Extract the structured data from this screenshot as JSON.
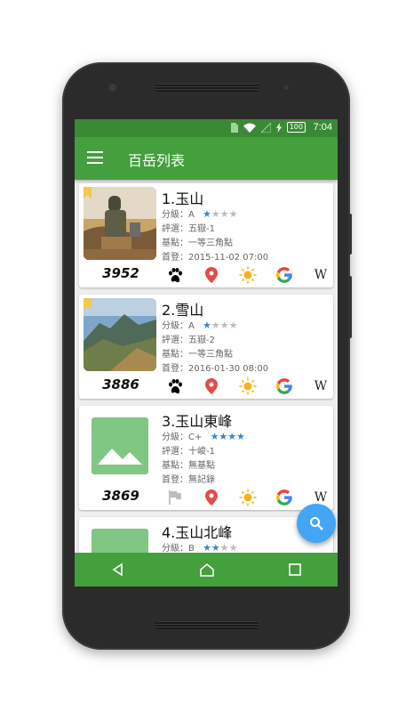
{
  "statusbar": {
    "time": "7:04",
    "battery": "100"
  },
  "appbar": {
    "title": "百岳列表"
  },
  "mountains": [
    {
      "name": "1.玉山",
      "grade": "分級：A",
      "stars": 1,
      "rating": "評選：五嶽-1",
      "base": "基點：一等三角點",
      "first": "首登：2015-11-02 07:00",
      "elevation": "3952",
      "climbed": true,
      "bookmarked": true
    },
    {
      "name": "2.雪山",
      "grade": "分級：A",
      "stars": 1,
      "rating": "評選：五嶽-2",
      "base": "基點：一等三角點",
      "first": "首登：2016-01-30 08:00",
      "elevation": "3886",
      "climbed": true,
      "bookmarked": true
    },
    {
      "name": "3.玉山東峰",
      "grade": "分級：C+",
      "stars": 4,
      "rating": "評選：十峻-1",
      "base": "基點：無基點",
      "first": "首登：無記錄",
      "elevation": "3869",
      "climbed": false,
      "bookmarked": false
    },
    {
      "name": "4.玉山北峰",
      "grade": "分級：B",
      "stars": 2,
      "rating": "",
      "base": "",
      "first": "",
      "elevation": "",
      "climbed": false,
      "bookmarked": false
    }
  ],
  "colors": {
    "primary": "#43a03d",
    "statusbar": "#3a8a35",
    "fab": "#42a5f5",
    "star": "#3d86c6",
    "placeholder": "#81c784"
  },
  "icons": [
    "menu-icon",
    "paw-icon",
    "flag-icon",
    "location-pin-icon",
    "sun-icon",
    "google-icon",
    "wikipedia-icon",
    "search-icon",
    "back-icon",
    "home-icon",
    "recents-icon"
  ]
}
